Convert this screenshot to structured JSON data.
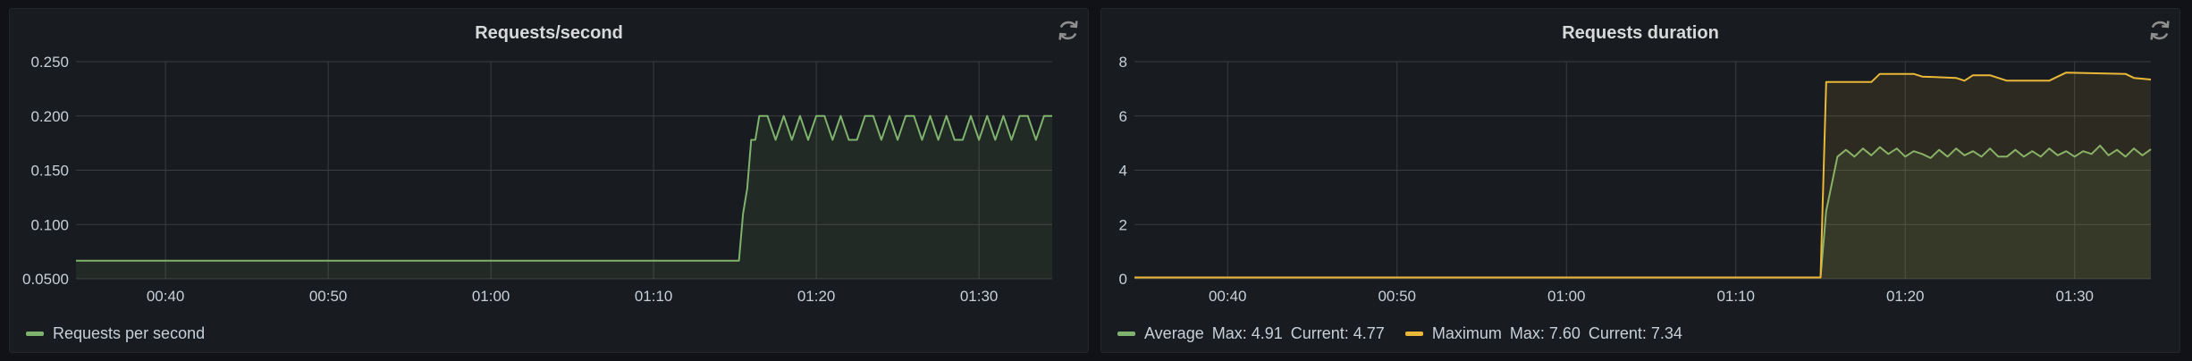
{
  "panels": [
    {
      "title": "Requests/second",
      "legend": [
        {
          "label": "Requests per second",
          "color": "#7eb26d"
        }
      ]
    },
    {
      "title": "Requests duration",
      "legend": [
        {
          "label": "Average",
          "max_text": "Max: 4.91",
          "current_text": "Current: 4.77",
          "color": "#7eb26d"
        },
        {
          "label": "Maximum",
          "max_text": "Max: 7.60",
          "current_text": "Current: 7.34",
          "color": "#eab839"
        }
      ]
    }
  ],
  "chart_data": [
    {
      "type": "line",
      "title": "Requests/second",
      "x_range": [
        "00:34:30",
        "01:34:30"
      ],
      "x_ticks": [
        "00:40",
        "00:50",
        "01:00",
        "01:10",
        "01:20",
        "01:30"
      ],
      "y_ticks": [
        "0.0500",
        "0.100",
        "0.150",
        "0.200",
        "0.250"
      ],
      "ylim": [
        0.05,
        0.25
      ],
      "grid": true,
      "legend_position": "bottom-left",
      "series": [
        {
          "name": "Requests per second",
          "color": "#7eb26d",
          "x": [
            "00:34:30",
            "01:15:15",
            "01:15:30",
            "01:15:45",
            "01:16:00",
            "01:16:15",
            "01:16:30",
            "01:17:00",
            "01:17:30",
            "01:18:00",
            "01:18:30",
            "01:19:00",
            "01:19:30",
            "01:20:00",
            "01:20:30",
            "01:21:00",
            "01:21:30",
            "01:22:00",
            "01:22:30",
            "01:23:00",
            "01:23:30",
            "01:24:00",
            "01:24:30",
            "01:25:00",
            "01:25:30",
            "01:26:00",
            "01:26:30",
            "01:27:00",
            "01:27:30",
            "01:28:00",
            "01:28:30",
            "01:29:00",
            "01:29:30",
            "01:30:00",
            "01:30:30",
            "01:31:00",
            "01:31:30",
            "01:32:00",
            "01:32:30",
            "01:33:00",
            "01:33:30",
            "01:34:00",
            "01:34:30"
          ],
          "values": [
            0.0667,
            0.0667,
            0.11,
            0.133,
            0.178,
            0.178,
            0.2,
            0.2,
            0.178,
            0.2,
            0.178,
            0.2,
            0.178,
            0.2,
            0.2,
            0.178,
            0.2,
            0.178,
            0.178,
            0.2,
            0.2,
            0.178,
            0.2,
            0.178,
            0.2,
            0.2,
            0.178,
            0.2,
            0.178,
            0.2,
            0.178,
            0.178,
            0.2,
            0.178,
            0.2,
            0.178,
            0.2,
            0.178,
            0.2,
            0.2,
            0.178,
            0.2,
            0.2
          ]
        }
      ]
    },
    {
      "type": "line",
      "title": "Requests duration",
      "x_range": [
        "00:34:30",
        "01:34:30"
      ],
      "x_ticks": [
        "00:40",
        "00:50",
        "01:00",
        "01:10",
        "01:20",
        "01:30"
      ],
      "y_ticks": [
        "0",
        "2",
        "4",
        "6",
        "8"
      ],
      "ylim": [
        0,
        8
      ],
      "grid": true,
      "legend_position": "bottom-left",
      "series": [
        {
          "name": "Average",
          "color": "#7eb26d",
          "x": [
            "00:34:30",
            "01:15:00",
            "01:15:20",
            "01:16:00",
            "01:16:30",
            "01:17:00",
            "01:17:30",
            "01:18:00",
            "01:18:30",
            "01:19:00",
            "01:19:30",
            "01:20:00",
            "01:20:30",
            "01:21:00",
            "01:21:30",
            "01:22:00",
            "01:22:30",
            "01:23:00",
            "01:23:30",
            "01:24:00",
            "01:24:30",
            "01:25:00",
            "01:25:30",
            "01:26:00",
            "01:26:30",
            "01:27:00",
            "01:27:30",
            "01:28:00",
            "01:28:30",
            "01:29:00",
            "01:29:30",
            "01:30:00",
            "01:30:30",
            "01:31:00",
            "01:31:30",
            "01:32:00",
            "01:32:30",
            "01:33:00",
            "01:33:30",
            "01:34:00",
            "01:34:30"
          ],
          "values": [
            0.05,
            0.05,
            2.5,
            4.5,
            4.75,
            4.5,
            4.8,
            4.55,
            4.85,
            4.6,
            4.8,
            4.5,
            4.7,
            4.6,
            4.45,
            4.75,
            4.5,
            4.8,
            4.55,
            4.7,
            4.5,
            4.8,
            4.5,
            4.5,
            4.75,
            4.5,
            4.7,
            4.5,
            4.8,
            4.55,
            4.7,
            4.5,
            4.7,
            4.6,
            4.91,
            4.55,
            4.75,
            4.5,
            4.8,
            4.55,
            4.77
          ]
        },
        {
          "name": "Maximum",
          "color": "#eab839",
          "x": [
            "00:34:30",
            "01:15:00",
            "01:15:20",
            "01:18:00",
            "01:18:30",
            "01:20:30",
            "01:21:00",
            "01:23:00",
            "01:23:30",
            "01:24:00",
            "01:25:00",
            "01:26:00",
            "01:28:30",
            "01:29:00",
            "01:29:30",
            "01:33:00",
            "01:33:30",
            "01:34:30"
          ],
          "values": [
            0.05,
            0.05,
            7.25,
            7.25,
            7.55,
            7.55,
            7.45,
            7.4,
            7.3,
            7.5,
            7.5,
            7.3,
            7.3,
            7.45,
            7.6,
            7.55,
            7.4,
            7.34
          ]
        }
      ]
    }
  ]
}
